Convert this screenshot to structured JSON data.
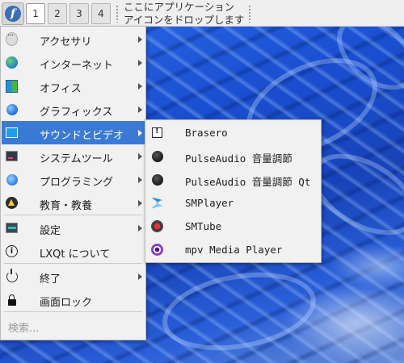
{
  "panel": {
    "menu_icon": "fedora-logo-icon",
    "menu_logo_glyph": "f",
    "desktops": [
      "1",
      "2",
      "3",
      "4"
    ],
    "active_desktop": "1",
    "quicklaunch_line1": "ここにアプリケーション",
    "quicklaunch_line2": "アイコンをドロップします"
  },
  "main_menu": {
    "items": [
      {
        "label": "アクセサリ",
        "icon": "accessories-icon",
        "submenu": true
      },
      {
        "label": "インターネット",
        "icon": "internet-globe-icon",
        "submenu": true
      },
      {
        "label": "オフィス",
        "icon": "office-icon",
        "submenu": true
      },
      {
        "label": "グラフィックス",
        "icon": "graphics-icon",
        "submenu": true
      },
      {
        "label": "サウンドとビデオ",
        "icon": "sound-video-icon",
        "submenu": true,
        "highlighted": true
      },
      {
        "label": "システムツール",
        "icon": "system-tools-icon",
        "submenu": true
      },
      {
        "label": "プログラミング",
        "icon": "programming-icon",
        "submenu": true
      },
      {
        "label": "教育・教養",
        "icon": "education-icon",
        "submenu": true
      },
      {
        "label": "設定",
        "icon": "settings-icon",
        "submenu": true
      },
      {
        "label": "LXQt について",
        "icon": "info-icon",
        "submenu": false
      },
      {
        "label": "終了",
        "icon": "power-icon",
        "submenu": true
      },
      {
        "label": "画面ロック",
        "icon": "lock-icon",
        "submenu": false
      }
    ],
    "search_placeholder": "検索..."
  },
  "sub_menu": {
    "items": [
      {
        "label": "Brasero",
        "icon": "brasero-icon"
      },
      {
        "label": "PulseAudio 音量調節",
        "icon": "pulseaudio-icon"
      },
      {
        "label": "PulseAudio 音量調節 Qt",
        "icon": "pulseaudio-qt-icon"
      },
      {
        "label": "SMPlayer",
        "icon": "smplayer-icon"
      },
      {
        "label": "SMTube",
        "icon": "smtube-icon"
      },
      {
        "label": "mpv Media Player",
        "icon": "mpv-icon"
      }
    ]
  },
  "colors": {
    "highlight": "#3b7ad4",
    "menu_bg": "#f1f1f1",
    "panel_bg": "#efefef"
  }
}
